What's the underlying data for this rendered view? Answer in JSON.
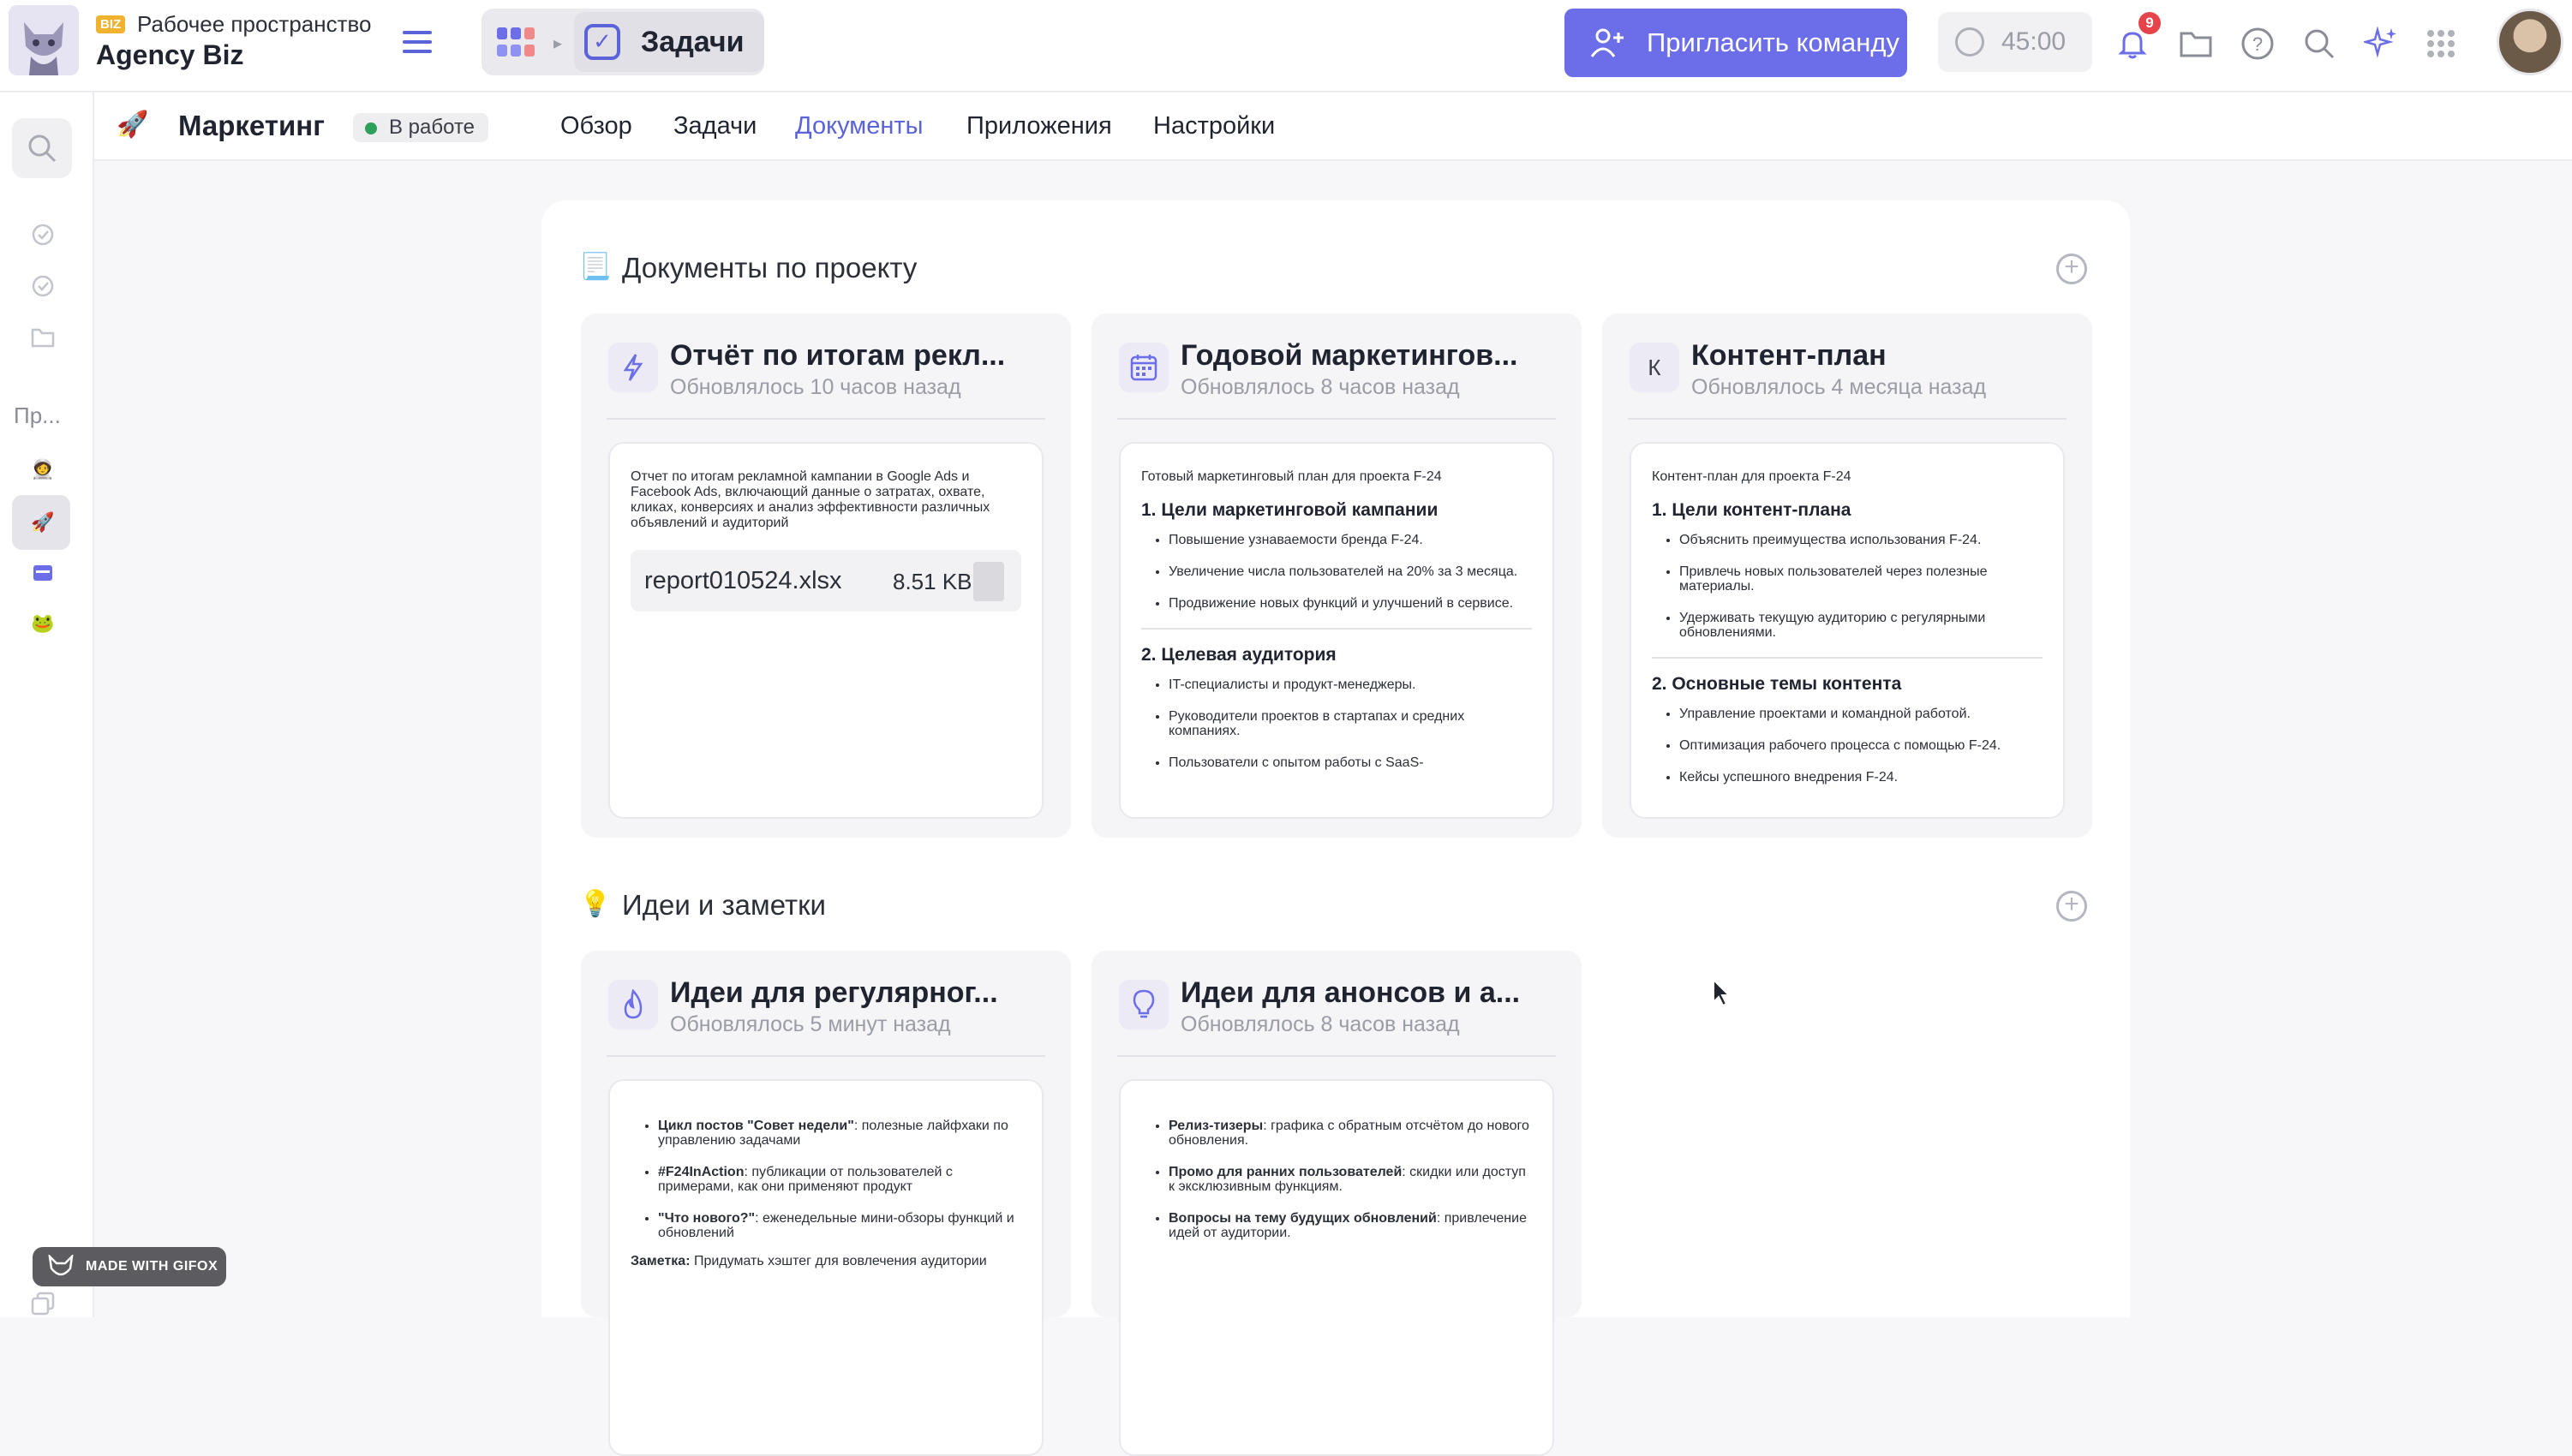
{
  "topbar": {
    "workspace_badge": "BIZ",
    "workspace_label": "Рабочее пространство",
    "workspace_name": "Agency Biz",
    "breadcrumb_current": "Задачи",
    "invite_label": "Пригласить команду",
    "timer_value": "45:00",
    "notifications_count": "9",
    "icons": [
      "menu-icon",
      "apps-grid-icon",
      "checkbox-icon",
      "user-plus-icon",
      "stopwatch-icon",
      "bell-icon",
      "folder-icon",
      "help-icon",
      "search-icon",
      "sparkles-icon",
      "grid-dots-icon"
    ]
  },
  "rail": {
    "projects_label": "Пр...",
    "gifox_label": "MADE WITH GIFOX"
  },
  "project": {
    "name": "Маркетинг",
    "status": "В работе",
    "tabs": [
      {
        "label": "Обзор"
      },
      {
        "label": "Задачи"
      },
      {
        "label": "Документы",
        "active": true
      },
      {
        "label": "Приложения"
      },
      {
        "label": "Настройки"
      }
    ]
  },
  "sections": [
    {
      "title": "Документы по проекту",
      "cards": [
        {
          "title": "Отчёт по итогам рекл...",
          "updated": "Обновлялось 10 часов назад",
          "intro": "Отчет по итогам рекламной кампании в Google Ads и Facebook Ads, включающий данные о затратах, охвате, кликах, конверсиях и анализ эффективности различных объявлений и аудиторий",
          "file_name": "report010524.xlsx",
          "file_size": "8.51 KB"
        },
        {
          "title": "Годовой маркетингов...",
          "updated": "Обновлялось 8 часов назад",
          "intro": "Готовый маркетинговый план для проекта F-24",
          "h1": "1. Цели маркетинговой кампании",
          "list1": [
            "Повышение узнаваемости бренда F-24.",
            "Увеличение числа пользователей на 20% за 3 месяца.",
            "Продвижение новых функций и улучшений в сервисе."
          ],
          "h2": "2. Целевая аудитория",
          "list2": [
            "IT-специалисты и продукт-менеджеры.",
            "Руководители проектов в стартапах и средних компаниях.",
            "Пользователи с опытом работы с SaaS-"
          ]
        },
        {
          "title": "Контент-план",
          "icon_letter": "К",
          "updated": "Обновлялось 4 месяца назад",
          "intro": "Контент-план для проекта F-24",
          "h1": "1. Цели контент-плана",
          "list1": [
            "Объяснить преимущества использования F-24.",
            "Привлечь новых пользователей через полезные материалы.",
            "Удерживать текущую аудиторию с регулярными обновлениями."
          ],
          "h2": "2. Основные темы контента",
          "list2": [
            "Управление проектами и командной работой.",
            "Оптимизация рабочего процесса с помощью F-24.",
            "Кейсы успешного внедрения F-24."
          ]
        }
      ]
    },
    {
      "title": "Идеи и заметки",
      "cards": [
        {
          "title": "Идеи для регулярног...",
          "updated": "Обновлялось 5 минут назад",
          "items": [
            {
              "bold": "Цикл постов \"Совет недели\"",
              "text": ": полезные лайфхаки по управлению задачами"
            },
            {
              "bold": "#F24InAction",
              "text": ": публикации от пользователей с примерами, как они применяют продукт"
            },
            {
              "bold": "\"Что нового?\"",
              "text": ": еженедельные мини-обзоры функций и обновлений"
            }
          ],
          "note_bold": "Заметка:",
          "note_text": " Придумать хэштег для вовлечения аудитории"
        },
        {
          "title": "Идеи для анонсов и а...",
          "updated": "Обновлялось 8 часов назад",
          "items": [
            {
              "bold": "Релиз-тизеры",
              "text": ": графика с обратным отсчётом до нового обновления."
            },
            {
              "bold": "Промо для ранних пользователей",
              "text": ": скидки или доступ к эксклюзивным функциям."
            },
            {
              "bold": "Вопросы на тему будущих обновлений",
              "text": ": привлечение идей от аудитории."
            }
          ]
        }
      ]
    }
  ],
  "colors": {
    "accent": "#5b63d9",
    "invite_bg": "#6b6ee8",
    "status_dot": "#2fa05a",
    "badge": "#f1b22f",
    "alert": "#e5454a"
  }
}
